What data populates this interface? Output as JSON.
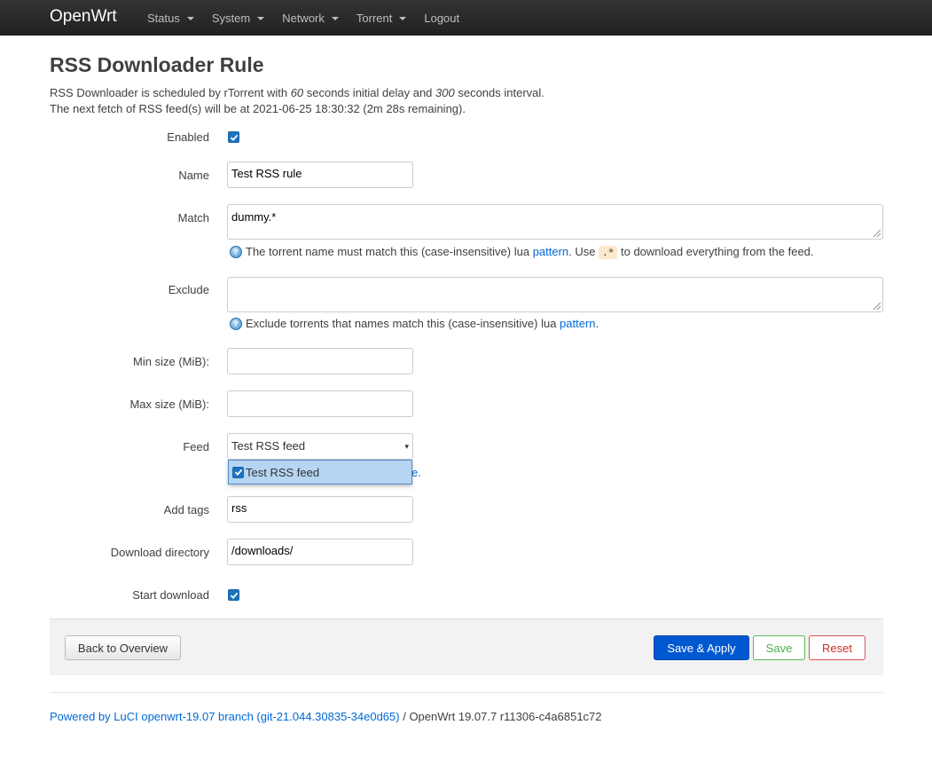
{
  "navbar": {
    "brand": "OpenWrt",
    "menu": [
      "Status",
      "System",
      "Network",
      "Torrent"
    ],
    "logout": "Logout"
  },
  "page": {
    "title": "RSS Downloader Rule",
    "desc_line1_a": "RSS Downloader is scheduled by rTorrent with ",
    "desc_line1_delay": "60",
    "desc_line1_b": " seconds initial delay and ",
    "desc_line1_interval": "300",
    "desc_line1_c": " seconds interval.",
    "desc_line2": "The next fetch of RSS feed(s) will be at 2021-06-25 18:30:32 (2m 28s remaining)."
  },
  "form": {
    "enabled": {
      "label": "Enabled",
      "checked": true
    },
    "name": {
      "label": "Name",
      "value": "Test RSS rule"
    },
    "match": {
      "label": "Match",
      "value": "dummy.*",
      "help_a": "The torrent name must match this (case-insensitive) lua ",
      "help_link": "pattern",
      "help_b": ". Use ",
      "help_code": ".*",
      "help_c": " to download everything from the feed."
    },
    "exclude": {
      "label": "Exclude",
      "value": "",
      "help_a": "Exclude torrents that names match this (case-insensitive) lua ",
      "help_link": "pattern",
      "help_b": "."
    },
    "min_size": {
      "label": "Min size (MiB):",
      "value": ""
    },
    "max_size": {
      "label": "Max size (MiB):",
      "value": ""
    },
    "feed": {
      "label": "Feed",
      "selected": "Test RSS feed",
      "arrow": "▾",
      "option": "Test RSS feed",
      "hidden_help_tail": "e."
    },
    "add_tags": {
      "label": "Add tags",
      "value": "rss"
    },
    "download_directory": {
      "label": "Download directory",
      "value": "/downloads/"
    },
    "start_download": {
      "label": "Start download",
      "checked": true
    }
  },
  "actions": {
    "back": "Back to Overview",
    "save_apply": "Save & Apply",
    "save": "Save",
    "reset": "Reset"
  },
  "footer": {
    "link": "Powered by LuCI openwrt-19.07 branch (git-21.044.30835-34e0d65)",
    "text": " / OpenWrt 19.07.7 r11306-c4a6851c72"
  },
  "colors": {
    "accent": "#0069d6",
    "primary_button": "#0058d0",
    "navbar": "#222222",
    "checkbox": "#1e73be",
    "dropdown_highlight": "#b5d5f3"
  },
  "icons": {
    "help": "help-icon",
    "caret": "caret-down-icon",
    "check": "check-icon"
  }
}
